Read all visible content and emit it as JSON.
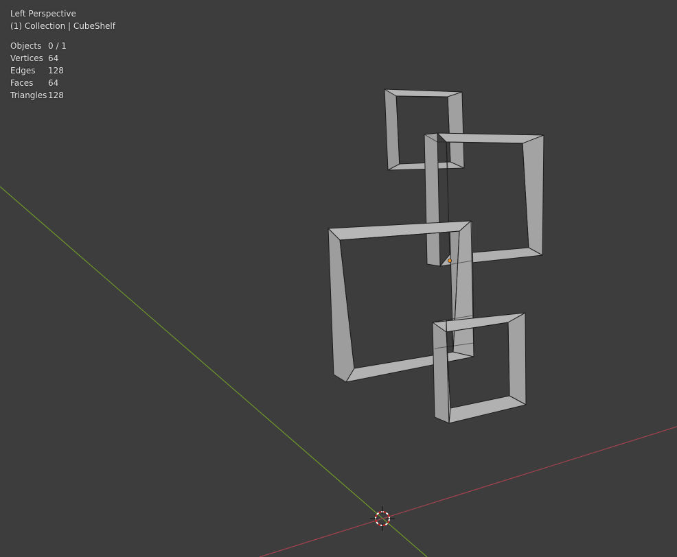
{
  "viewport": {
    "view_name": "Left Perspective",
    "collection_line": "(1) Collection | CubeShelf"
  },
  "stats": [
    {
      "label": "Objects",
      "value": "0 / 1"
    },
    {
      "label": "Vertices",
      "value": "64"
    },
    {
      "label": "Edges",
      "value": "128"
    },
    {
      "label": "Faces",
      "value": "64"
    },
    {
      "label": "Triangles",
      "value": "128"
    }
  ],
  "colors": {
    "background": "#3d3d3d",
    "axis_y": "#6f9a2a",
    "axis_x": "#a1424f",
    "mesh_face": "#9c9c9c",
    "mesh_edge": "#1c1c1c",
    "origin": "#f08c1c"
  }
}
